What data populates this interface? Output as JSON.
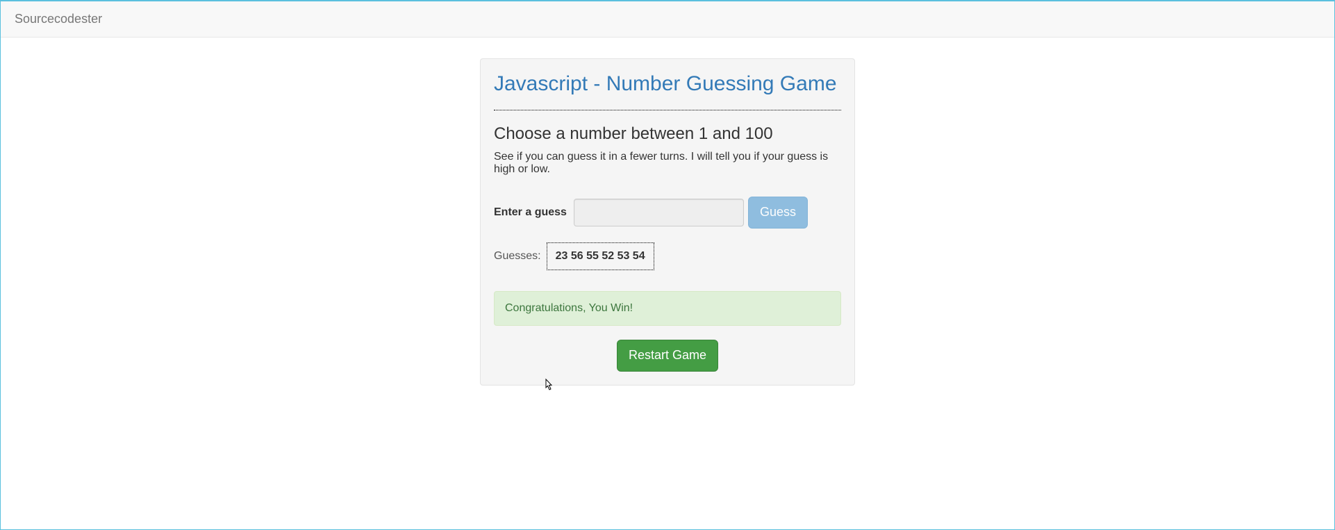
{
  "navbar": {
    "brand": "Sourcecodester"
  },
  "panel": {
    "title": "Javascript - Number Guessing Game",
    "subtitle": "Choose a number between 1 and 100",
    "description": "See if you can guess it in a fewer turns. I will tell you if your guess is high or low.",
    "input_label": "Enter a guess",
    "guess_button": "Guess",
    "guesses_label": "Guesses:",
    "guesses_list": "23 56 55 52 53 54",
    "result_message": "Congratulations, You Win!",
    "restart_button": "Restart Game"
  }
}
